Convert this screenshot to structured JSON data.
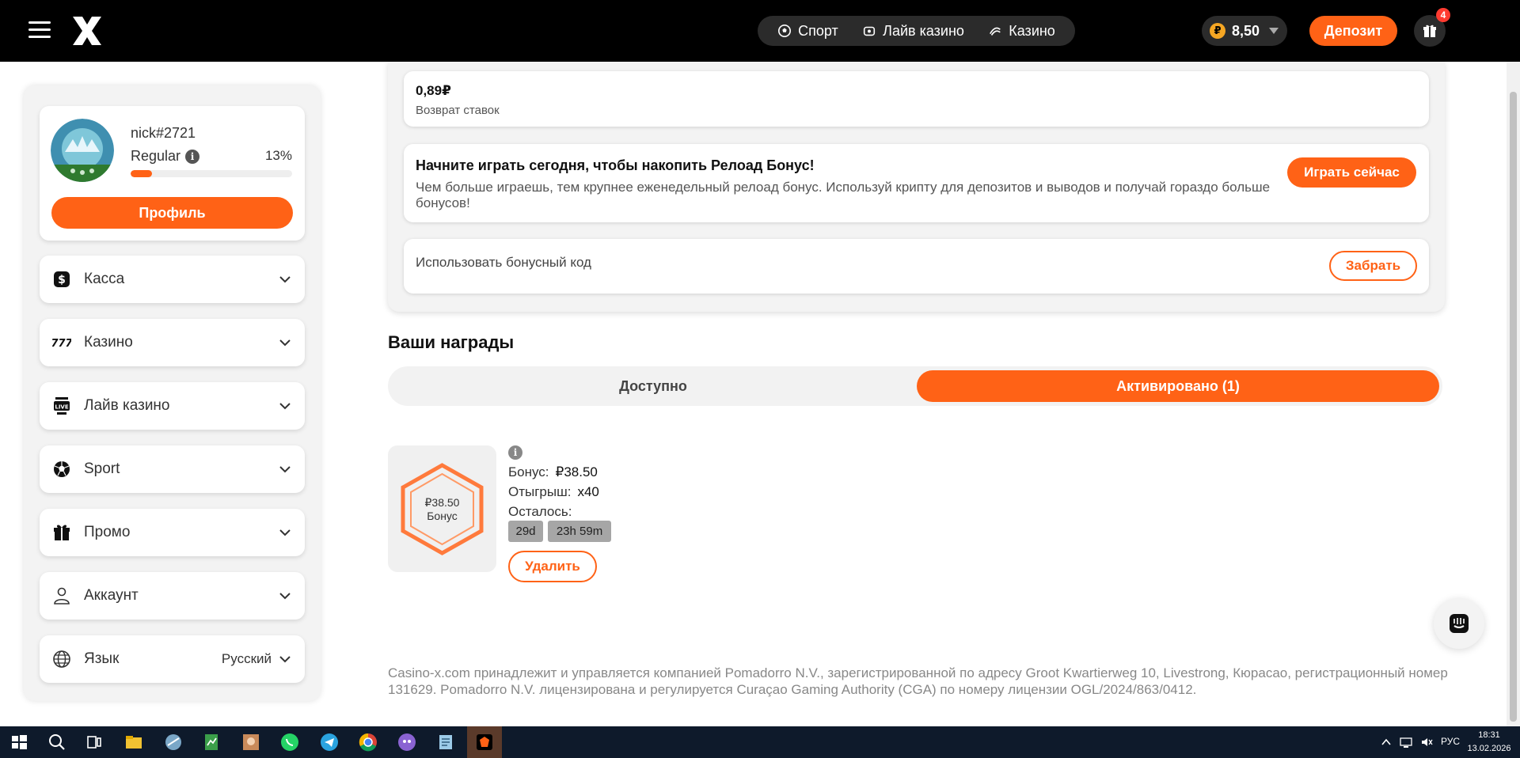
{
  "header": {
    "nav": [
      {
        "label": "Спорт",
        "icon": "soccer-ball-icon"
      },
      {
        "label": "Лайв казино",
        "icon": "live-casino-icon"
      },
      {
        "label": "Казино",
        "icon": "casino-icon"
      }
    ],
    "balance": {
      "currency_symbol": "₽",
      "value": "8,50"
    },
    "deposit_label": "Депозит",
    "gift_badge": "4"
  },
  "sidebar": {
    "profile": {
      "nickname": "nick#2721",
      "level": "Regular",
      "progress_percent_label": "13%",
      "progress_value": 13,
      "button_label": "Профиль"
    },
    "items": [
      {
        "label": "Касса",
        "icon": "cashier-dollar-icon"
      },
      {
        "label": "Казино",
        "icon": "slots-777-icon"
      },
      {
        "label": "Лайв казино",
        "icon": "live-tv-icon"
      },
      {
        "label": "Sport",
        "icon": "soccer-ball-icon"
      },
      {
        "label": "Промо",
        "icon": "gift-icon"
      },
      {
        "label": "Аккаунт",
        "icon": "user-icon"
      },
      {
        "label": "Язык",
        "icon": "globe-icon",
        "value": "Русский"
      }
    ]
  },
  "bonuses": {
    "cashback": {
      "value": "0,89₽",
      "label": "Возврат ставок"
    },
    "reload": {
      "title": "Начните играть сегодня, чтобы накопить Релоад Бонус!",
      "text": "Чем больше играешь, тем крупнее еженедельный релоад бонус. Используй крипту для депозитов и выводов и получай гораздо больше бонусов!",
      "button_label": "Играть сейчас"
    },
    "promo": {
      "placeholder": "Использовать бонусный код",
      "button_label": "Забрать"
    }
  },
  "rewards": {
    "title": "Ваши награды",
    "tabs": {
      "available": "Доступно",
      "activated": "Активировано (1)"
    },
    "item": {
      "tile_amount": "₽38.50",
      "tile_label": "Бонус",
      "bonus_label": "Бонус:",
      "bonus_value": "₽38.50",
      "wager_label": "Отыгрыш:",
      "wager_value": "x40",
      "remaining_label": "Осталось:",
      "remaining_days": "29d",
      "remaining_time": "23h 59m",
      "delete_label": "Удалить"
    }
  },
  "footer": {
    "legal": "Casino-x.com принадлежит и управляется компанией Pomadorro N.V., зарегистрированной по адресу Groot Kwartierweg 10, Livestrong, Кюрасао, регистрационный номер 131629. Pomadorro N.V. лицензирована и регулируется Curaçao Gaming Authority (CGA) по номеру лицензии OGL/2024/863/0412."
  },
  "taskbar": {
    "language": "РУС",
    "time": "18:31",
    "date": "13.02.2026"
  },
  "colors": {
    "accent": "#ff6216",
    "header_bg": "#000000",
    "panel_bg": "#f3f3f3"
  }
}
